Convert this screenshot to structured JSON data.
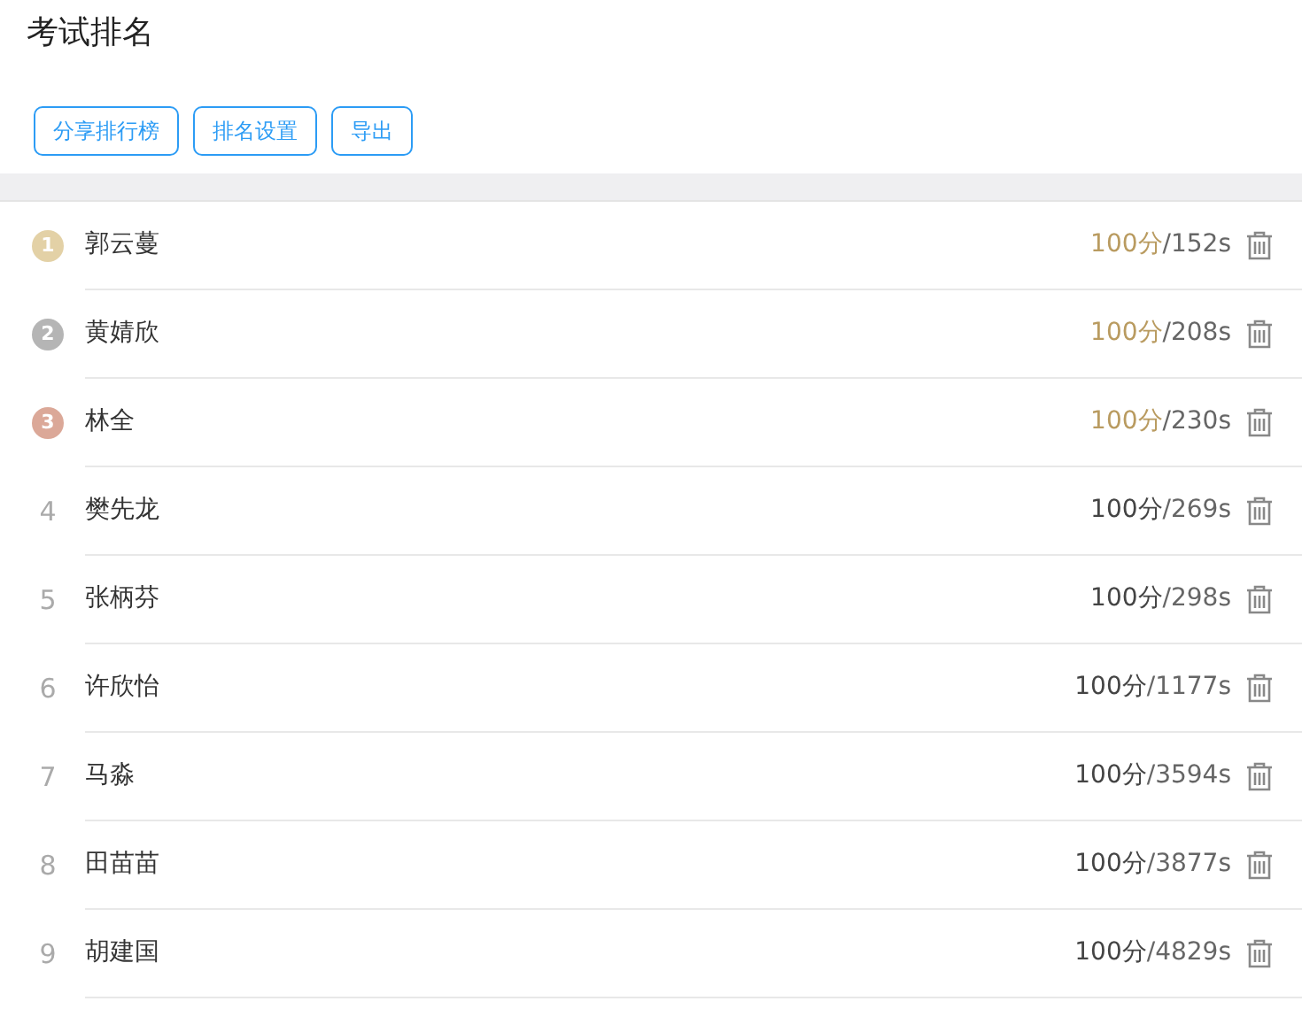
{
  "title": "考试排名",
  "buttons": [
    "分享排行榜",
    "排名设置",
    "导出"
  ],
  "rankings": [
    {
      "rank": "1",
      "kind": "medal",
      "color": "#e3d1a6",
      "name": "郭云蔓",
      "score": "100分",
      "time": "/152s",
      "highlight": true
    },
    {
      "rank": "2",
      "kind": "medal",
      "color": "#b5b5b5",
      "name": "黄婧欣",
      "score": "100分",
      "time": "/208s",
      "highlight": true
    },
    {
      "rank": "3",
      "kind": "medal",
      "color": "#dba898",
      "name": "林全",
      "score": "100分",
      "time": "/230s",
      "highlight": true
    },
    {
      "rank": "4",
      "kind": "plain",
      "name": "樊先龙",
      "score": "100分",
      "time": "/269s",
      "highlight": false
    },
    {
      "rank": "5",
      "kind": "plain",
      "name": "张柄芬",
      "score": "100分",
      "time": "/298s",
      "highlight": false
    },
    {
      "rank": "6",
      "kind": "plain",
      "name": "许欣怡",
      "score": "100分",
      "time": "/1177s",
      "highlight": false
    },
    {
      "rank": "7",
      "kind": "plain",
      "name": "马淼",
      "score": "100分",
      "time": "/3594s",
      "highlight": false
    },
    {
      "rank": "8",
      "kind": "plain",
      "name": "田苗苗",
      "score": "100分",
      "time": "/3877s",
      "highlight": false
    },
    {
      "rank": "9",
      "kind": "plain",
      "name": "胡建国",
      "score": "100分",
      "time": "/4829s",
      "highlight": false
    }
  ]
}
